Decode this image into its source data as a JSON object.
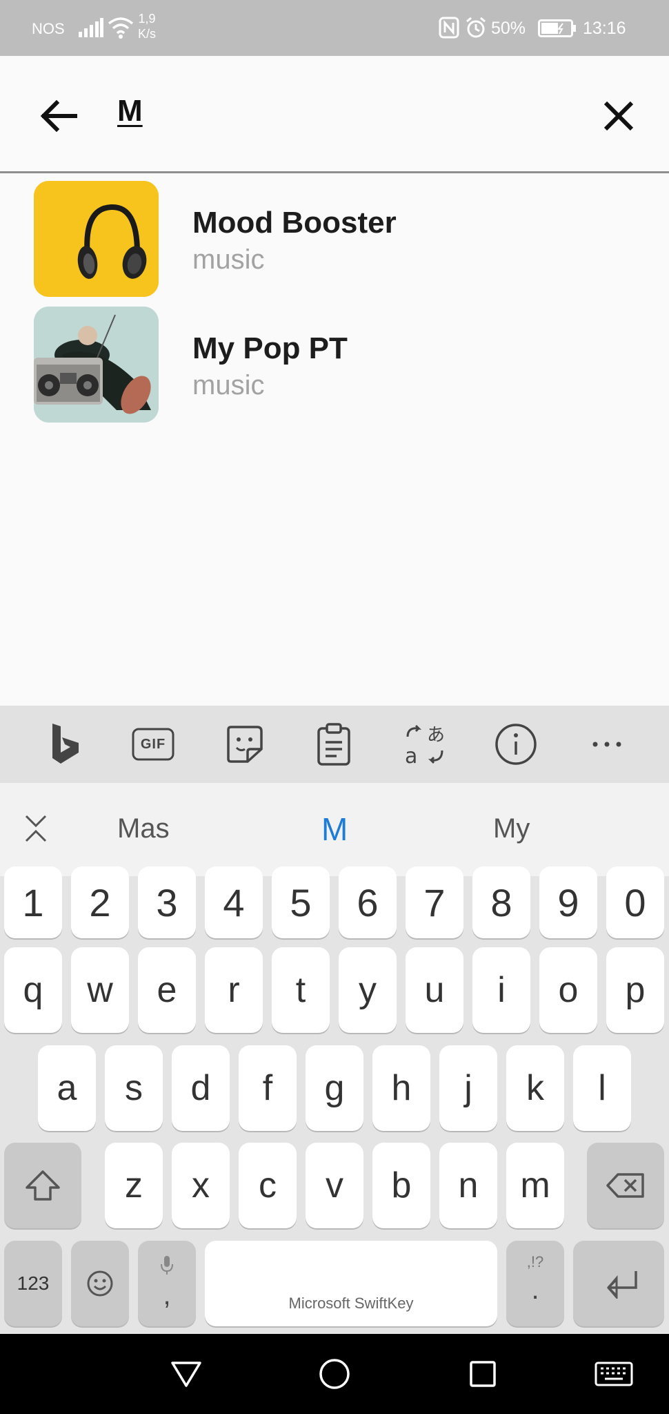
{
  "status_bar": {
    "carrier": "NOS",
    "speed_value": "1,9",
    "speed_unit": "K/s",
    "battery": "50%",
    "time": "13:16"
  },
  "search": {
    "query": "M"
  },
  "results": [
    {
      "title": "Mood Booster",
      "subtitle": "music"
    },
    {
      "title": "My Pop PT",
      "subtitle": "music"
    }
  ],
  "keyboard": {
    "toolbar_icons": [
      "bing-icon",
      "gif-icon",
      "sticker-icon",
      "clipboard-icon",
      "translate-icon",
      "info-icon",
      "more-icon"
    ],
    "gif_label": "GIF",
    "suggestions": [
      "Mas",
      "M",
      "My"
    ],
    "row_numbers": [
      "1",
      "2",
      "3",
      "4",
      "5",
      "6",
      "7",
      "8",
      "9",
      "0"
    ],
    "row1": [
      "q",
      "w",
      "e",
      "r",
      "t",
      "y",
      "u",
      "i",
      "o",
      "p"
    ],
    "row2": [
      "a",
      "s",
      "d",
      "f",
      "g",
      "h",
      "j",
      "k",
      "l"
    ],
    "row3": [
      "z",
      "x",
      "c",
      "v",
      "b",
      "n",
      "m"
    ],
    "numbers_key": "123",
    "comma_key": ",",
    "period_key": ".",
    "punct_hint": ",!?",
    "space_label": "Microsoft SwiftKey"
  }
}
